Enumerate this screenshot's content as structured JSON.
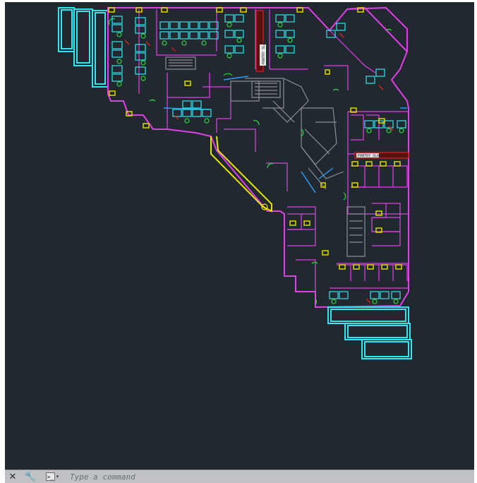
{
  "command_line": {
    "placeholder": "Type a command",
    "close_icon": "close-icon",
    "customize_icon": "wrench-icon",
    "prompt_icon": "command-prompt-icon",
    "prompt_glyph": ">_"
  },
  "drawing": {
    "labels": {
      "pantry_top": "PANTRY SLAB",
      "pantry_right": "PANTRY SLAB"
    }
  },
  "colors": {
    "canvas_bg": "#212830",
    "wall": "#e040e8",
    "furniture": "#33e6f0",
    "door": "#2bd93b",
    "yellow": "#e6e600",
    "red": "#e02020",
    "blue": "#2aa0ff",
    "gray": "#8c8f93",
    "white": "#e8e8e8"
  }
}
